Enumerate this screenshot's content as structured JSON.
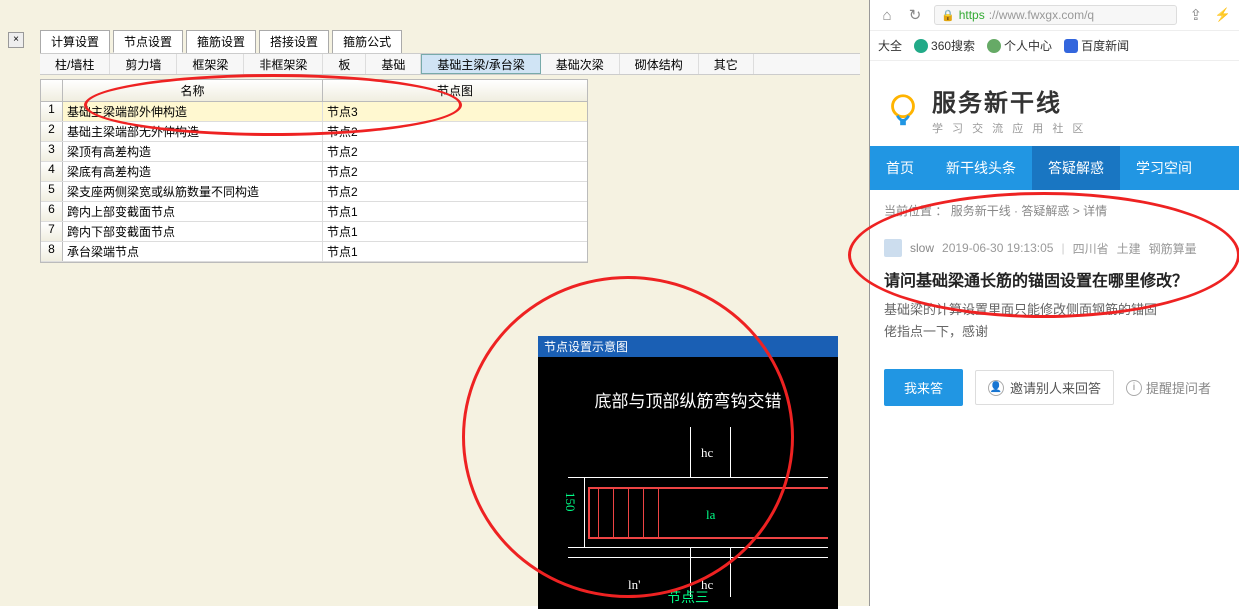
{
  "left_app": {
    "top_tabs": [
      "计算设置",
      "节点设置",
      "箍筋设置",
      "搭接设置",
      "箍筋公式"
    ],
    "top_active": 1,
    "sub_tabs": [
      "柱/墙柱",
      "剪力墙",
      "框架梁",
      "非框架梁",
      "板",
      "基础",
      "基础主梁/承台梁",
      "基础次梁",
      "砌体结构",
      "其它"
    ],
    "sub_active": 6,
    "cols": {
      "name": "名称",
      "img": "节点图"
    },
    "rows": [
      {
        "n": "1",
        "name": "基础主梁端部外伸构造",
        "img": "节点3"
      },
      {
        "n": "2",
        "name": "基础主梁端部无外伸构造",
        "img": "节点2"
      },
      {
        "n": "3",
        "name": "梁顶有高差构造",
        "img": "节点2"
      },
      {
        "n": "4",
        "name": "梁底有高差构造",
        "img": "节点2"
      },
      {
        "n": "5",
        "name": "梁支座两侧梁宽或纵筋数量不同构造",
        "img": "节点2"
      },
      {
        "n": "6",
        "name": "跨内上部变截面节点",
        "img": "节点1"
      },
      {
        "n": "7",
        "name": "跨内下部变截面节点",
        "img": "节点1"
      },
      {
        "n": "8",
        "name": "承台梁端节点",
        "img": "节点1"
      }
    ]
  },
  "diagram": {
    "title": "节点设置示意图",
    "top_text": "底部与顶部纵筋弯钩交错",
    "label_hc1": "hc",
    "label_hc2": "hc",
    "label_ln": "ln'",
    "label_la": "la",
    "label_150": "150",
    "bottom_text": "节点三"
  },
  "browser": {
    "url_prefix": "https",
    "url_host": "://www.fwxgx.com/q",
    "bookmarks_dq": "大全",
    "bookmarks": [
      "360搜索",
      "个人中心",
      "百度新闻"
    ],
    "logo_main": "服务新干线",
    "logo_sub": "学 习 交 流 应 用 社 区",
    "nav": [
      "首页",
      "新干线头条",
      "答疑解惑",
      "学习空间"
    ],
    "nav_active": 2,
    "breadcrumb_prefix": "当前位置 ：",
    "breadcrumb": [
      "服务新干线",
      "答疑解惑",
      "详情"
    ],
    "post": {
      "author": "slow",
      "time": "2019-06-30 19:13:05",
      "region": "四川省",
      "cat1": "土建",
      "cat2": "钢筋算量",
      "title": "请问基础梁通长筋的锚固设置在哪里修改？",
      "body_l1": "基础梁的计算设置里面只能修改侧面钢筋的锚固",
      "body_l2": "佬指点一下，感谢"
    },
    "answer_btn": "我来答",
    "invite": "邀请别人来回答",
    "remind": "提醒提问者"
  }
}
